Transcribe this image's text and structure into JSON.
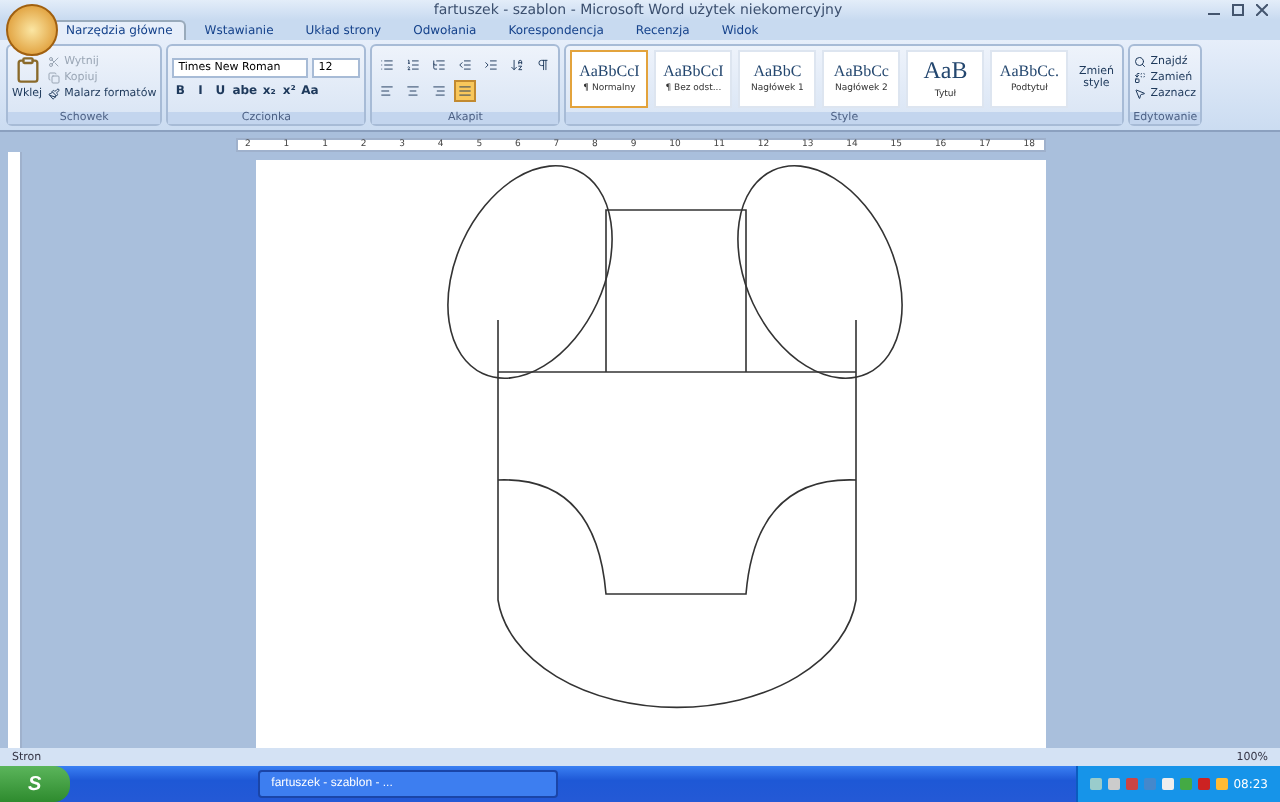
{
  "window": {
    "title": "fartuszek - szablon - Microsoft Word użytek niekomercyjny"
  },
  "tabs": [
    {
      "label": "Narzędzia główne",
      "selected": true
    },
    {
      "label": "Wstawianie",
      "selected": false
    },
    {
      "label": "Układ strony",
      "selected": false
    },
    {
      "label": "Odwołania",
      "selected": false
    },
    {
      "label": "Korespondencja",
      "selected": false
    },
    {
      "label": "Recenzja",
      "selected": false
    },
    {
      "label": "Widok",
      "selected": false
    }
  ],
  "clipboard": {
    "title": "Schowek",
    "paste": "Wklej",
    "items": [
      {
        "label": "Wytnij",
        "disabled": true
      },
      {
        "label": "Kopiuj",
        "disabled": true
      },
      {
        "label": "Malarz formatów",
        "disabled": false
      }
    ]
  },
  "font": {
    "title": "Czcionka",
    "name": "Times New Roman",
    "size": "12",
    "format_buttons": [
      "B",
      "I",
      "U",
      "abe",
      "x₂",
      "x²",
      "Aa"
    ]
  },
  "paragraph": {
    "title": "Akapit",
    "alignment_buttons": [
      {
        "selected": false
      },
      {
        "selected": false
      },
      {
        "selected": false
      },
      {
        "selected": true
      }
    ]
  },
  "styles": {
    "title": "Style",
    "items": [
      {
        "sample": "AaBbCcI",
        "label": "¶ Normalny",
        "selected": true
      },
      {
        "sample": "AaBbCcI",
        "label": "¶ Bez odst...",
        "selected": false
      },
      {
        "sample": "AaBbC",
        "label": "Nagłówek 1",
        "selected": false
      },
      {
        "sample": "AaBbCc",
        "label": "Nagłówek 2",
        "selected": false
      },
      {
        "sample": "AaB",
        "label": "Tytuł",
        "selected": false
      },
      {
        "sample": "AaBbCc.",
        "label": "Podtytuł",
        "selected": false
      }
    ],
    "change": "Zmień style"
  },
  "editing": {
    "title": "Edytowanie",
    "items": [
      "Znajdź",
      "Zamień",
      "Zaznacz"
    ]
  },
  "ruler": [
    "2",
    "1",
    "1",
    "2",
    "3",
    "4",
    "5",
    "6",
    "7",
    "8",
    "9",
    "10",
    "11",
    "12",
    "13",
    "14",
    "15",
    "16",
    "17",
    "18"
  ],
  "status_bar": {
    "page": "Stron",
    "zoom": "100%"
  },
  "taskbar": {
    "start": "S",
    "task": "fartuszek - szablon - ...",
    "clock": "08:23"
  }
}
